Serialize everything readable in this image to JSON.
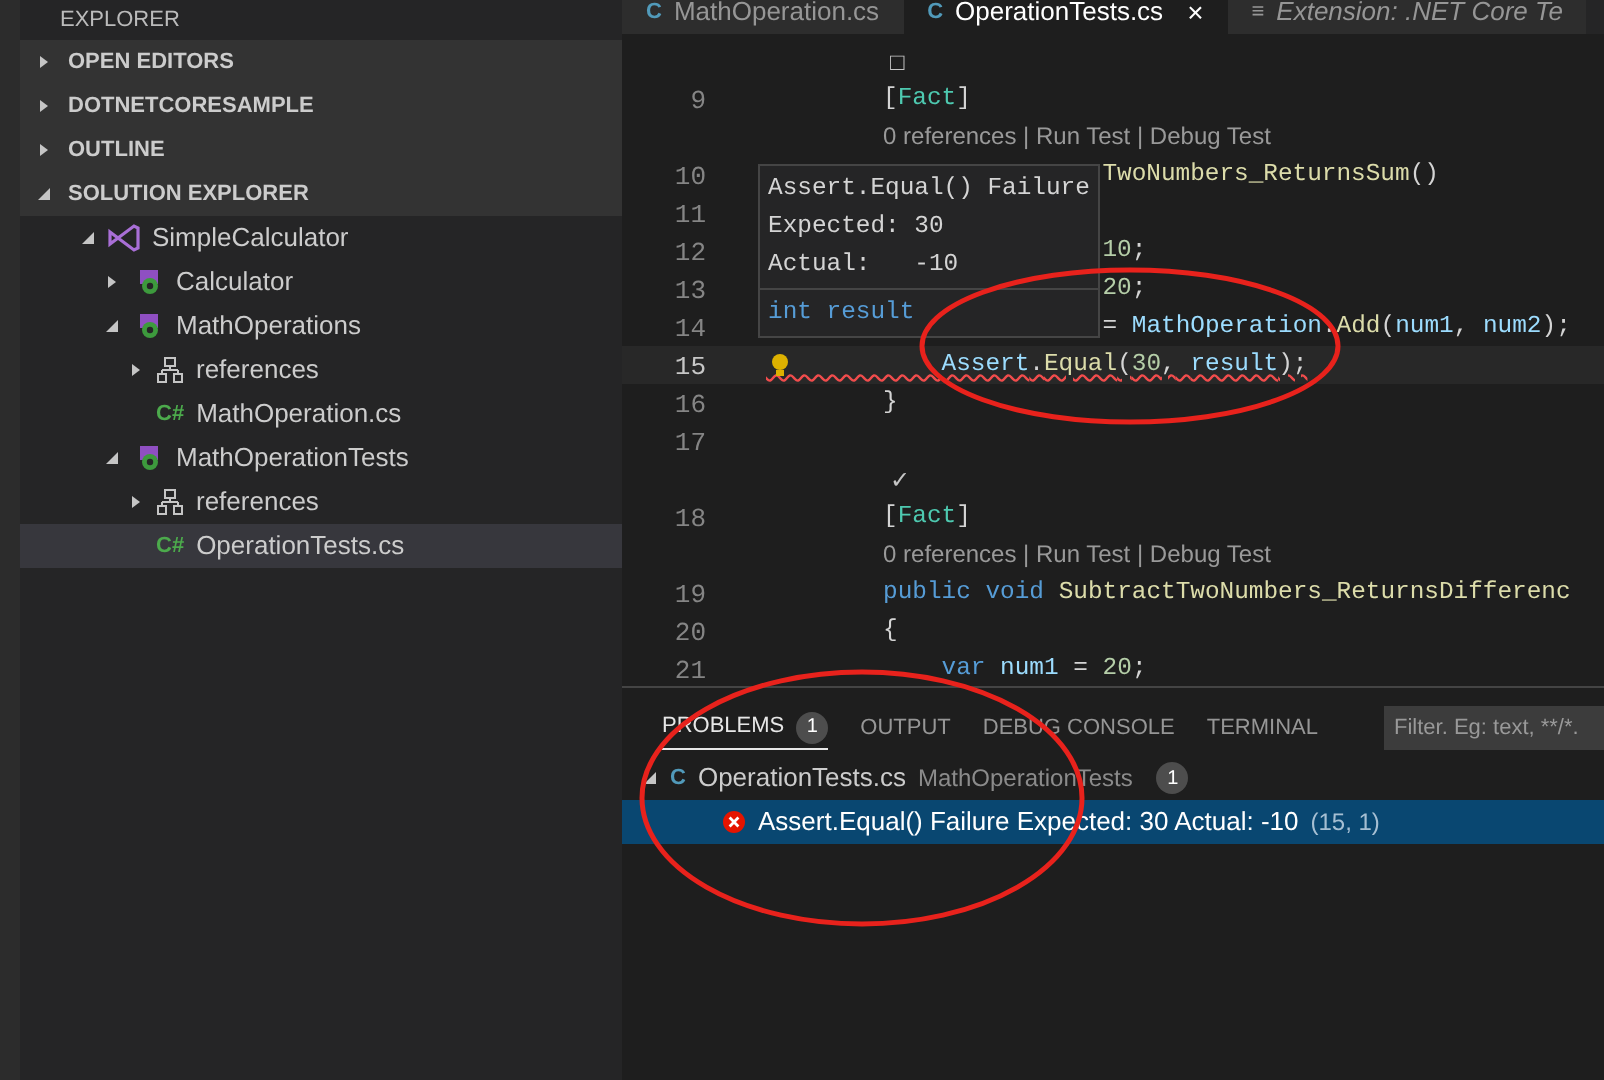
{
  "sidebar": {
    "title": "EXPLORER",
    "sections": [
      {
        "label": "OPEN EDITORS",
        "expanded": false
      },
      {
        "label": "DOTNETCORESAMPLE",
        "expanded": false
      },
      {
        "label": "OUTLINE",
        "expanded": false
      },
      {
        "label": "SOLUTION EXPLORER",
        "expanded": true
      }
    ],
    "tree": [
      {
        "label": "SimpleCalculator",
        "kind": "solution",
        "expanded": true,
        "selected": false,
        "children": [
          {
            "label": "Calculator",
            "kind": "project",
            "expanded": false,
            "selected": false
          },
          {
            "label": "MathOperations",
            "kind": "project",
            "expanded": true,
            "selected": false,
            "children": [
              {
                "label": "references",
                "kind": "references",
                "expanded": false,
                "selected": false
              },
              {
                "label": "MathOperation.cs",
                "kind": "csharp",
                "icon": "C#",
                "selected": false
              }
            ]
          },
          {
            "label": "MathOperationTests",
            "kind": "project",
            "expanded": true,
            "selected": false,
            "children": [
              {
                "label": "references",
                "kind": "references",
                "expanded": false,
                "selected": false
              },
              {
                "label": "OperationTests.cs",
                "kind": "csharp",
                "icon": "C#",
                "selected": true
              }
            ]
          }
        ]
      }
    ]
  },
  "tabs": [
    {
      "label": "MathOperation.cs",
      "icon": "C",
      "kind": "csharp",
      "selected": false
    },
    {
      "label": "OperationTests.cs",
      "icon": "C",
      "kind": "csharp",
      "selected": true,
      "close": "×"
    },
    {
      "label": "Extension: .NET Core Te",
      "icon": "≡",
      "kind": "extension",
      "selected": false
    }
  ],
  "editor": {
    "lines": [
      {
        "kind": "status",
        "glyph": "□"
      },
      {
        "kind": "code",
        "number": "9",
        "tokens": [
          {
            "t": "        [",
            "kind": "plain"
          },
          {
            "t": "Fact",
            "kind": "type"
          },
          {
            "t": "]",
            "kind": "plain"
          }
        ]
      },
      {
        "kind": "lens",
        "tokens": [
          {
            "t": "        0 references | Run Test | Debug Test",
            "kind": "lens"
          }
        ]
      },
      {
        "kind": "code",
        "number": "10",
        "tokens": [
          {
            "t": "                       TwoNumbers_ReturnsSum",
            "kind": "func"
          },
          {
            "t": "()",
            "kind": "plain"
          }
        ]
      },
      {
        "kind": "code",
        "number": "11"
      },
      {
        "kind": "code",
        "number": "12",
        "tokens": [
          {
            "t": "                       10",
            "kind": "number"
          },
          {
            "t": ";",
            "kind": "plain"
          }
        ]
      },
      {
        "kind": "code",
        "number": "13",
        "tokens": [
          {
            "t": "                       20",
            "kind": "number"
          },
          {
            "t": ";",
            "kind": "plain"
          }
        ]
      },
      {
        "kind": "code",
        "number": "14",
        "tokens": [
          {
            "t": "                       = ",
            "kind": "plain"
          },
          {
            "t": "MathOperation",
            "kind": "var"
          },
          {
            "t": ".",
            "kind": "plain"
          },
          {
            "t": "Add",
            "kind": "func"
          },
          {
            "t": "(",
            "kind": "plain"
          },
          {
            "t": "num1",
            "kind": "var"
          },
          {
            "t": ", ",
            "kind": "plain"
          },
          {
            "t": "num2",
            "kind": "var"
          },
          {
            "t": ");",
            "kind": "plain"
          }
        ]
      },
      {
        "kind": "code",
        "number": "15",
        "current": true,
        "error": true,
        "tokens": [
          {
            "t": "            Assert",
            "kind": "var"
          },
          {
            "t": ".",
            "kind": "plain"
          },
          {
            "t": "Equal",
            "kind": "func"
          },
          {
            "t": "(",
            "kind": "plain"
          },
          {
            "t": "30",
            "kind": "number"
          },
          {
            "t": ", ",
            "kind": "plain"
          },
          {
            "t": "result",
            "kind": "var"
          },
          {
            "t": ");",
            "kind": "plain"
          }
        ]
      },
      {
        "kind": "code",
        "number": "16",
        "tokens": [
          {
            "t": "        }",
            "kind": "plain"
          }
        ]
      },
      {
        "kind": "code",
        "number": "17"
      },
      {
        "kind": "status",
        "glyph": "✓"
      },
      {
        "kind": "code",
        "number": "18",
        "tokens": [
          {
            "t": "        [",
            "kind": "plain"
          },
          {
            "t": "Fact",
            "kind": "type"
          },
          {
            "t": "]",
            "kind": "plain"
          }
        ]
      },
      {
        "kind": "lens",
        "tokens": [
          {
            "t": "        0 references | Run Test | Debug Test",
            "kind": "lens"
          }
        ]
      },
      {
        "kind": "code",
        "number": "19",
        "tokens": [
          {
            "t": "        public",
            "kind": "keyword"
          },
          {
            "t": " void",
            "kind": "keyword"
          },
          {
            "t": " SubtractTwoNumbers_ReturnsDifferenc",
            "kind": "func"
          }
        ]
      },
      {
        "kind": "code",
        "number": "20",
        "tokens": [
          {
            "t": "        {",
            "kind": "plain"
          }
        ]
      },
      {
        "kind": "code",
        "number": "21",
        "tokens": [
          {
            "t": "            var",
            "kind": "keyword"
          },
          {
            "t": " num1",
            "kind": "var"
          },
          {
            "t": " = ",
            "kind": "plain"
          },
          {
            "t": "20",
            "kind": "number"
          },
          {
            "t": ";",
            "kind": "plain"
          }
        ]
      }
    ],
    "hover": {
      "message": [
        "Assert.Equal() Failure",
        "Expected: 30",
        "Actual:   -10"
      ],
      "signature": "int result"
    }
  },
  "panel": {
    "tabs": [
      {
        "label": "PROBLEMS",
        "selected": true,
        "badge": "1"
      },
      {
        "label": "OUTPUT",
        "selected": false
      },
      {
        "label": "DEBUG CONSOLE",
        "selected": false
      },
      {
        "label": "TERMINAL",
        "selected": false
      }
    ],
    "filter": {
      "placeholder": "Filter. Eg: text, **/*."
    },
    "file": {
      "icon": "C",
      "name": "OperationTests.cs",
      "folder": "MathOperationTests",
      "count": "1",
      "expanded": true
    },
    "problems": [
      {
        "kind": "error",
        "message": "Assert.Equal() Failure Expected: 30 Actual: -10",
        "location": "(15, 1)",
        "selected": true
      }
    ]
  }
}
